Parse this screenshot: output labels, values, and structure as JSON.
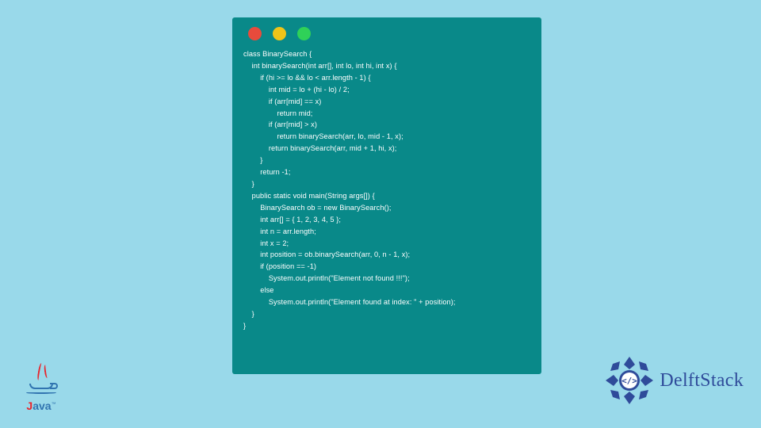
{
  "window": {
    "dots": [
      "red",
      "yellow",
      "green"
    ]
  },
  "code": "class BinarySearch {\n    int binarySearch(int arr[], int lo, int hi, int x) {\n        if (hi >= lo && lo < arr.length - 1) {\n            int mid = lo + (hi - lo) / 2;\n            if (arr[mid] == x)\n                return mid;\n            if (arr[mid] > x)\n                return binarySearch(arr, lo, mid - 1, x);\n            return binarySearch(arr, mid + 1, hi, x);\n        }\n        return -1;\n    }\n    public static void main(String args[]) {\n        BinarySearch ob = new BinarySearch();\n        int arr[] = { 1, 2, 3, 4, 5 };\n        int n = arr.length;\n        int x = 2;\n        int position = ob.binarySearch(arr, 0, n - 1, x);\n        if (position == -1)\n            System.out.println(\"Element not found !!!\");\n        else\n            System.out.println(\"Element found at index: \" + position);\n    }\n}",
  "logos": {
    "java_label": "Java",
    "java_tm": "™",
    "delftstack_label": "DelftStack"
  }
}
